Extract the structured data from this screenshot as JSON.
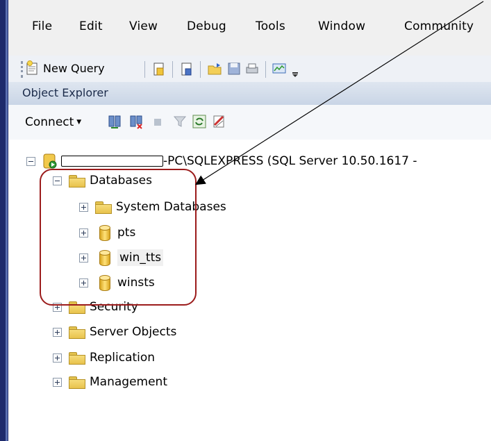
{
  "menu": [
    "File",
    "Edit",
    "View",
    "Debug",
    "Tools",
    "Window",
    "Community"
  ],
  "toolbar": {
    "new_query_label": "New Query"
  },
  "object_explorer": {
    "title": "Object Explorer",
    "connect_label": "Connect"
  },
  "tree": {
    "server_label": "-PC\\SQLEXPRESS (SQL Server 10.50.1617 -",
    "databases": "Databases",
    "system_databases": "System Databases",
    "db1": "pts",
    "db2": "win_tts",
    "db3": "winsts",
    "security": "Security",
    "server_objects": "Server Objects",
    "replication": "Replication",
    "management": "Management"
  }
}
